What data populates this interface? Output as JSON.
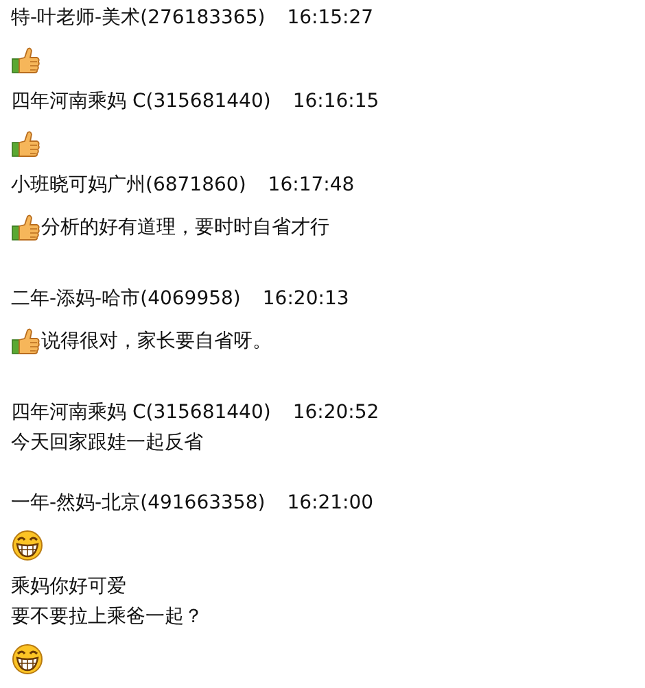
{
  "messages": [
    {
      "sender": "特-叶老师-美术(276183365)",
      "time": "16:15:27",
      "lines": [
        [
          {
            "kind": "thumbs-up"
          }
        ]
      ]
    },
    {
      "sender": "四年河南乘妈 C(315681440)",
      "time": "16:16:15",
      "lines": [
        [
          {
            "kind": "thumbs-up"
          }
        ]
      ]
    },
    {
      "sender": "小班晓可妈广州(6871860)",
      "time": "16:17:48",
      "lines": [
        [
          {
            "kind": "thumbs-up"
          },
          {
            "kind": "text",
            "text": "分析的好有道理，要时时自省才行"
          }
        ],
        [
          {
            "kind": "blank"
          }
        ]
      ]
    },
    {
      "sender": "二年-添妈-哈市(4069958)",
      "time": "16:20:13",
      "lines": [
        [
          {
            "kind": "thumbs-up"
          },
          {
            "kind": "text",
            "text": "说得很对，家长要自省呀。"
          }
        ],
        [
          {
            "kind": "blank"
          }
        ]
      ]
    },
    {
      "sender": "四年河南乘妈 C(315681440)",
      "time": "16:20:52",
      "lines": [
        [
          {
            "kind": "text",
            "text": "今天回家跟娃一起反省"
          }
        ],
        [
          {
            "kind": "blank"
          }
        ]
      ]
    },
    {
      "sender": "一年-然妈-北京(491663358)",
      "time": "16:21:00",
      "lines": [
        [
          {
            "kind": "grin"
          }
        ],
        [
          {
            "kind": "text",
            "text": "乘妈你好可爱"
          }
        ],
        [
          {
            "kind": "text",
            "text": "要不要拉上乘爸一起？"
          }
        ],
        [
          {
            "kind": "grin"
          }
        ]
      ]
    }
  ]
}
